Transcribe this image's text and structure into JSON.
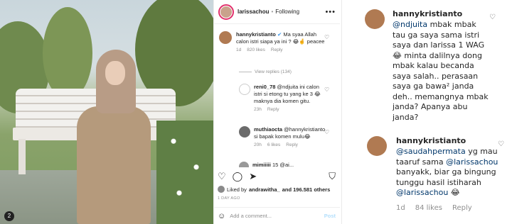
{
  "post": {
    "username": "larissachou",
    "separator": "•",
    "follow_state": "Following",
    "more_icon": "•••"
  },
  "comments": [
    {
      "user": "hannykristianto",
      "text": "Ma syaa Allah calon istri siapa ya ini ? 😂🤞 peacee",
      "time": "1d",
      "likes": "820 likes",
      "reply": "Reply",
      "view_replies": "View replies (134)"
    },
    {
      "user": "reni0_78",
      "text": "@ndjuita ini calon istri si etong tu yang ke 3 😂 maknya dia komen gitu.",
      "time": "23h",
      "likes": "",
      "reply": "Reply"
    },
    {
      "user": "muthiaocta",
      "text": "@hannykristianto si bapak komen mulu😂",
      "time": "20h",
      "likes": "6 likes",
      "reply": "Reply"
    },
    {
      "user": "mimiiiii",
      "text": "15 @ai..."
    }
  ],
  "actions": {
    "like_icon": "♡",
    "comment_icon": "◯",
    "share_icon": "➤",
    "save_icon": "⛉"
  },
  "likes_line": {
    "prefix": "Liked by",
    "user": "andrawitha_",
    "suffix": "and 196.581 others"
  },
  "post_date": "1 DAY AGO",
  "add_comment": {
    "emoji_icon": "☺",
    "placeholder": "Add a comment...",
    "post_label": "Post"
  },
  "zoom_top": {
    "user": "hannykristianto",
    "mention": "@ndjuita",
    "text": " mbak mbak tau ga saya sama istri saya dan larissa 1 WAG 😂 minta dalilnya dong mbak kalau becanda saya salah.. perasaan saya ga bawa² janda deh.. memangnya mbak janda? Apanya abu janda?"
  },
  "zoom_bottom": {
    "user": "hannykristianto",
    "mention1": "@saudahpermata",
    "text1": " yg mau taaruf sama ",
    "mention2": "@larissachou",
    "text2": " banyakk, biar ga bingung tunggu hasil istiharah ",
    "mention3": "@larissachou",
    "text3": " 😂",
    "time": "1d",
    "likes": "84 likes",
    "reply": "Reply"
  },
  "photo_badge": "2"
}
